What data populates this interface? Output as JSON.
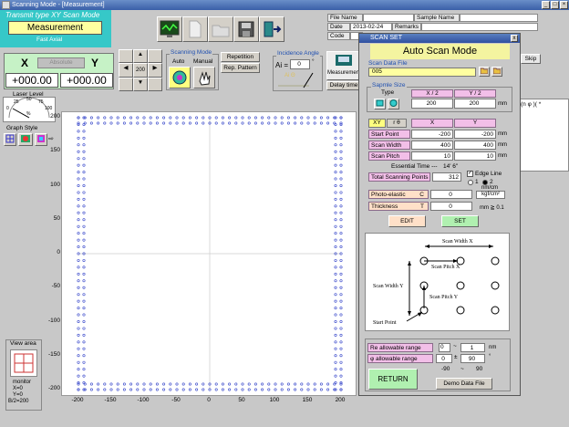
{
  "window": {
    "title": "Scanning Mode - [Measurement]"
  },
  "header": {
    "mode_title": "Transmit type XY Scan Mode",
    "measurement": "Measurement",
    "fast_axial": "Fast Axial",
    "absolute": "Absolute",
    "x_label": "X",
    "y_label": "Y",
    "x_value": "+000.00",
    "y_value": "+000.00",
    "step_value": "200"
  },
  "fileinfo": {
    "file_name_label": "File Name",
    "sample_name_label": "Sample Name",
    "date_label": "Date",
    "date_value": "2013-02-24",
    "remarks_label": "Remarks",
    "code_label": "Code"
  },
  "scanning_mode": {
    "title": "Scanning Mode",
    "auto": "Auto",
    "manual": "Manual",
    "repetition": "Repetition",
    "rep_pattern": "Rep. Pattern"
  },
  "incidence": {
    "title": "Incidence Angle",
    "ai_label": "Ai =",
    "ai_value": "0",
    "ai_unit": "°",
    "ai_hint": "Ai Θ"
  },
  "measure_btn": "Measurement",
  "delay_time": "Delay time",
  "skip": "Skip",
  "laser_level": {
    "title": "Laser Level",
    "ticks": [
      "0",
      "25",
      "50",
      "75",
      "100"
    ],
    "unit": "%"
  },
  "graph_style": {
    "title": "Graph Style"
  },
  "view_area": {
    "title": "View area",
    "monitor": "monitor",
    "x": "X=0",
    "y": "Y=0",
    "b": "B/2=200"
  },
  "plot": {
    "yticks": [
      "200",
      "150",
      "100",
      "50",
      "0",
      "-50",
      "-100",
      "-150",
      "-200"
    ],
    "xticks": [
      "-200",
      "-150",
      "-100",
      "-50",
      "0",
      "50",
      "100",
      "150",
      "200"
    ]
  },
  "right_panel": {
    "phi_label": "(n φ )( *"
  },
  "dialog": {
    "title": "SCAN SET",
    "close": "x",
    "heading": "Auto Scan Mode",
    "scan_data_file_label": "Scan Data File",
    "scan_data_file_value": "005",
    "sample_size_title": "Sapmle Size",
    "type_label": "Type",
    "x2_label": "X / 2",
    "y2_label": "Y / 2",
    "x2_value": "200",
    "y2_value": "200",
    "mm": "mm",
    "xy_tab": "XY",
    "rtheta_tab": "r θ",
    "col_x": "X",
    "col_y": "Y",
    "start_point_label": "Start Point",
    "start_x": "-200",
    "start_y": "-200",
    "scan_width_label": "Scan Width",
    "width_x": "400",
    "width_y": "400",
    "scan_pitch_label": "Scan Pitch",
    "pitch_x": "10",
    "pitch_y": "10",
    "essential_time_label": "Essential Time ---",
    "essential_time_value": "14' 6\"",
    "total_label": "Total Scanning Points",
    "total_value": "312",
    "edge_line_label": "Edge Line",
    "edge_opt1": "1",
    "edge_opt2": "2",
    "photo_label": "Photo-elastic",
    "photo_sym": "C",
    "photo_value": "0",
    "photo_unit1": "nm/cm",
    "photo_unit2": "kgf/cm²",
    "thickness_label": "Thickness",
    "thickness_sym": "T",
    "thickness_value": "0",
    "thickness_unit": "mm ≧ 0.1",
    "edit": "EDIT",
    "set": "SET",
    "diag_scan_width_x": "Scan Width X",
    "diag_scan_pitch_x": "Scan Pitch X",
    "diag_scan_width_y": "Scan Width Y",
    "diag_scan_pitch_y": "Scan Pitch Y",
    "diag_start_point": "Start Point",
    "re_label": "Re allowable range",
    "re_min": "0",
    "re_tilde": "~",
    "re_max": "1",
    "re_unit": "nm",
    "phi_label": "φ allowable range",
    "phi_center": "0",
    "phi_pm": "±",
    "phi_width": "90",
    "phi_unit": "°",
    "phi_min": "-90",
    "phi_tilde": "~",
    "phi_max": "90",
    "return": "RETURN",
    "demo": "Demo Data File"
  }
}
